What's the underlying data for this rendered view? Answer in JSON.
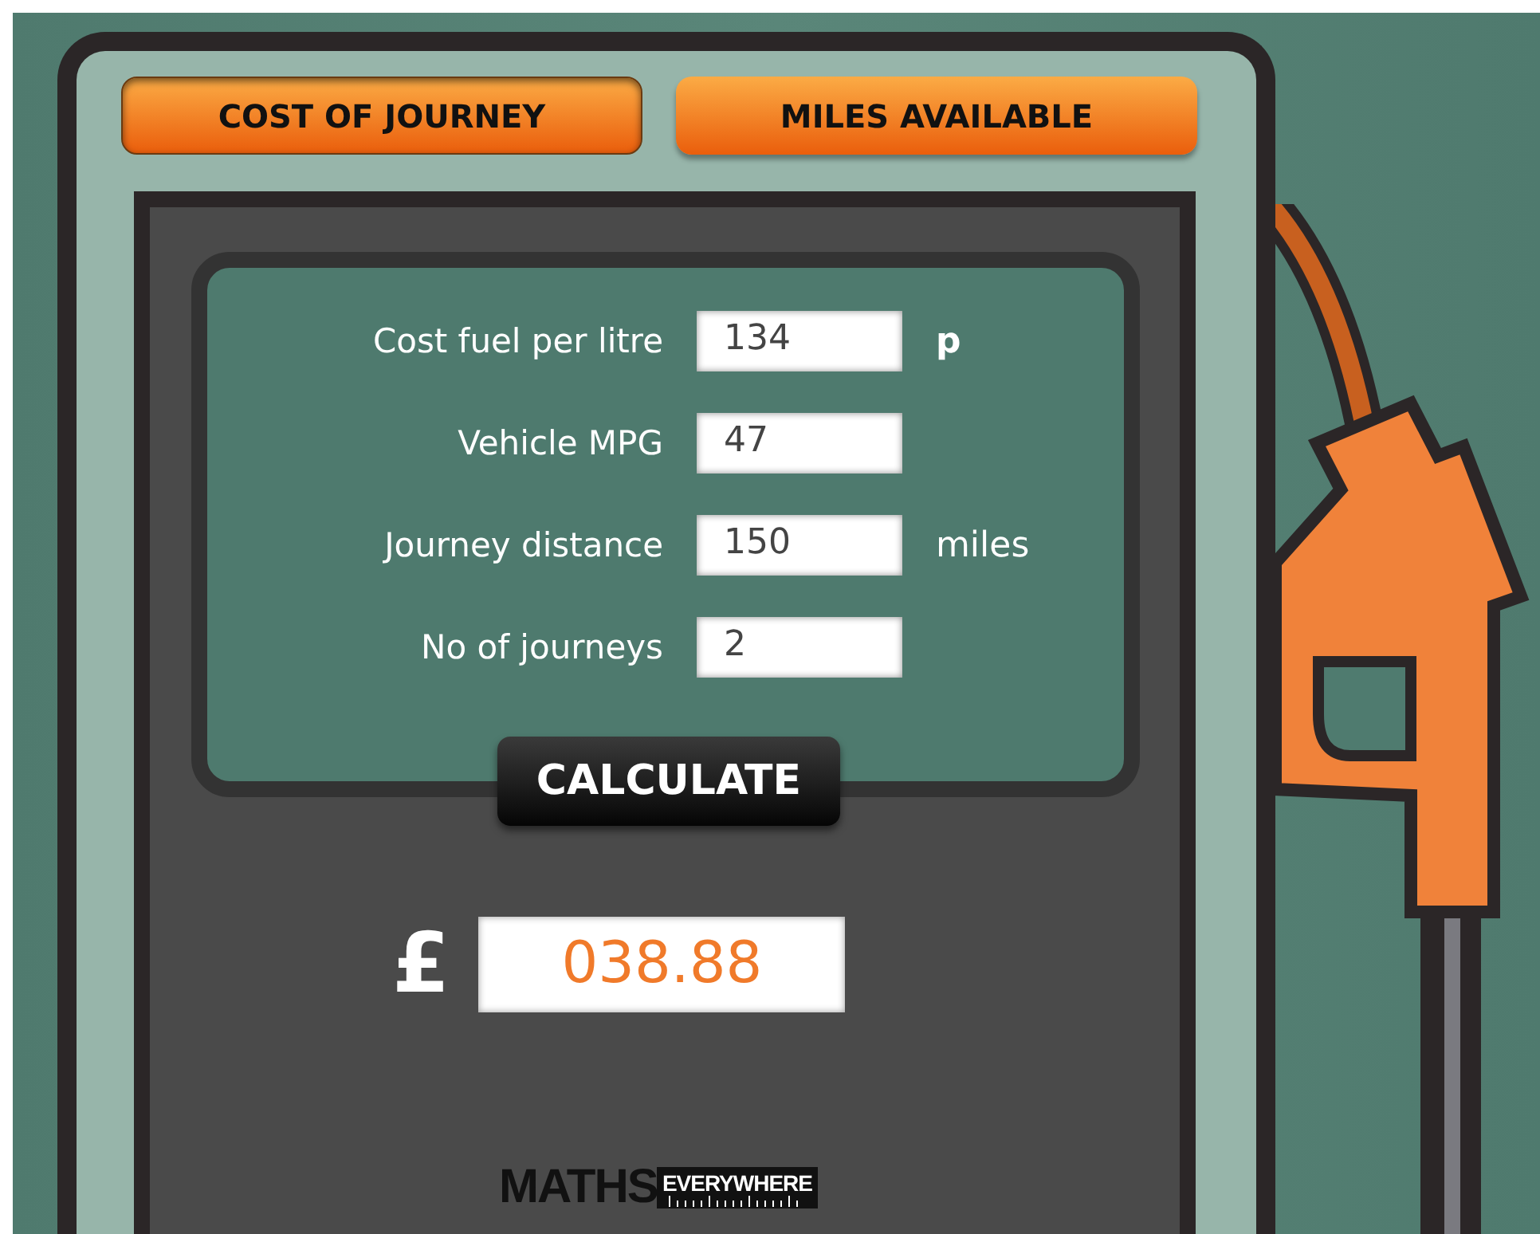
{
  "tabs": [
    {
      "label": "COST OF JOURNEY",
      "selected": true
    },
    {
      "label": "MILES AVAILABLE",
      "selected": false
    }
  ],
  "fields": [
    {
      "label": "Cost fuel per litre",
      "value": "134",
      "unit": "p",
      "unit_bold": true
    },
    {
      "label": "Vehicle MPG",
      "value": "47"
    },
    {
      "label": "Journey distance",
      "value": "150",
      "unit": "miles",
      "unit_bold": false
    },
    {
      "label": "No of journeys",
      "value": "2"
    }
  ],
  "calculate_button": {
    "label": "CALCULATE"
  },
  "result": {
    "currency": "£",
    "value": "038.88"
  },
  "logo": {
    "word_1": "MATHS",
    "word_2": "EVERYWHERE"
  }
}
